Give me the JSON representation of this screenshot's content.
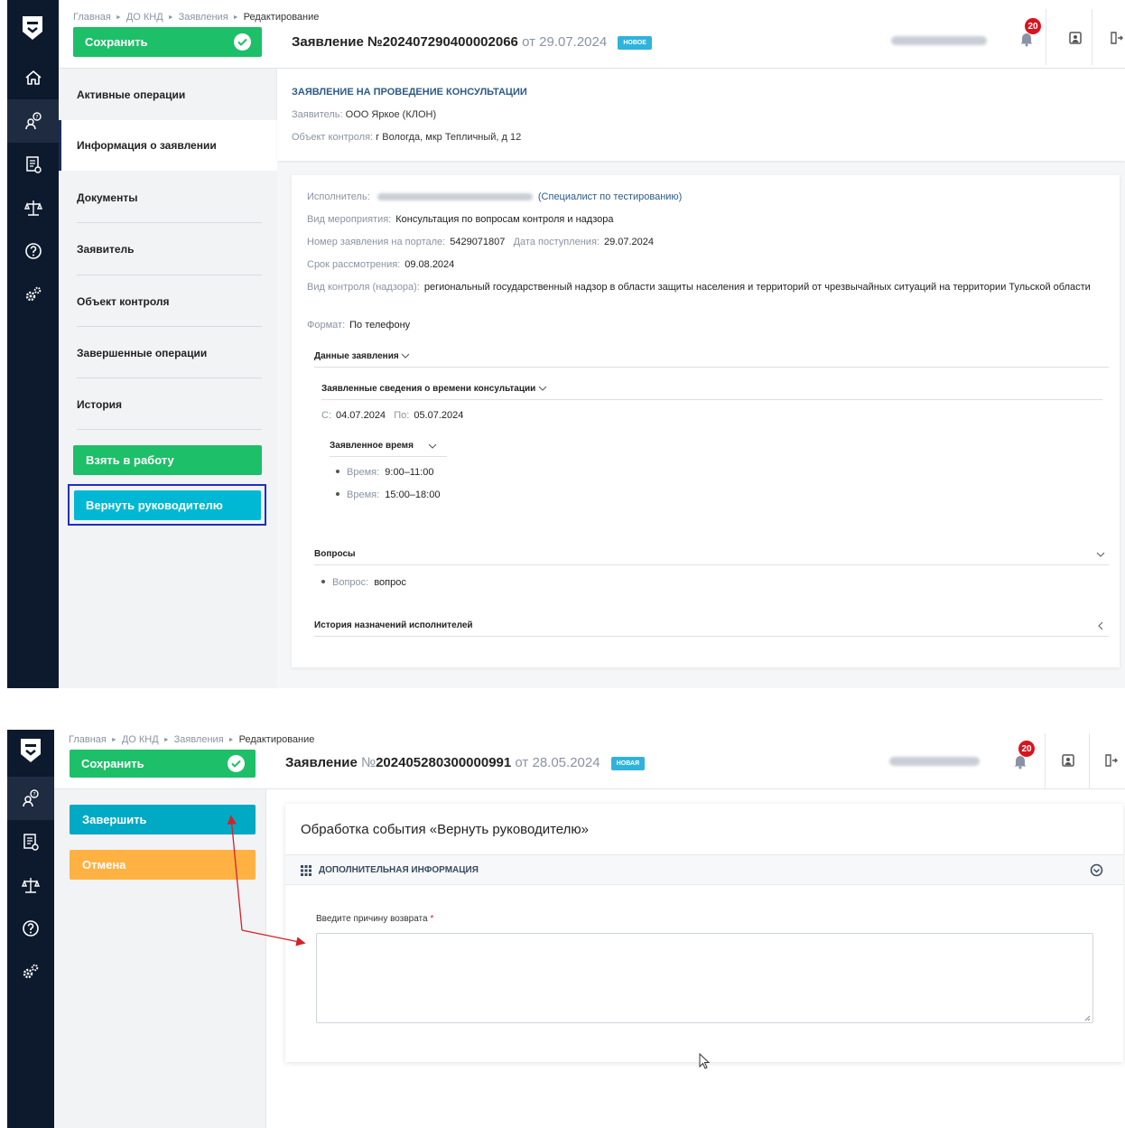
{
  "screen1": {
    "breadcrumbs": [
      "Главная",
      "ДО КНД",
      "Заявления",
      "Редактирование"
    ],
    "save_label": "Сохранить",
    "title": {
      "prefix": "Заявление",
      "number_sign": "№",
      "number": "202407290400002066",
      "date_prefix": "от",
      "date": "29.07.2024",
      "badge": "НОВОЕ"
    },
    "notifications_count": "20",
    "sidebar": {
      "items": [
        {
          "label": "Активные операции"
        },
        {
          "label": "Информация о заявлении"
        },
        {
          "label": "Документы"
        },
        {
          "label": "Заявитель"
        },
        {
          "label": "Объект контроля"
        },
        {
          "label": "Завершенные операции"
        },
        {
          "label": "История"
        }
      ],
      "take_to_work": "Взять в работу",
      "return_to_manager": "Вернуть руководителю"
    },
    "header_card": {
      "title": "ЗАЯВЛЕНИЕ НА ПРОВЕДЕНИЕ КОНСУЛЬТАЦИИ",
      "applicant_label": "Заявитель:",
      "applicant": "ООО Яркое (КЛОН)",
      "object_label": "Объект контроля:",
      "object": "г Вологда, мкр Тепличный, д 12"
    },
    "details": {
      "executor_label": "Исполнитель:",
      "executor_role": "(Специалист по тестированию)",
      "event_type_label": "Вид мероприятия:",
      "event_type": "Консультация по вопросам контроля и надзора",
      "portal_number_label": "Номер заявления на портале:",
      "portal_number": "5429071807",
      "received_label": "Дата поступления:",
      "received": "29.07.2024",
      "deadline_label": "Срок рассмотрения:",
      "deadline": "09.08.2024",
      "control_type_label": "Вид контроля (надзора):",
      "control_type": "региональный государственный надзор в области защиты населения и территорий от чрезвычайных ситуаций на территории Тульской области",
      "format_label": "Формат:",
      "format": "По телефону",
      "app_data_section": "Данные заявления",
      "time_info_section": "Заявленные сведения о времени консультации",
      "from_label": "С:",
      "from": "04.07.2024",
      "to_label": "По:",
      "to": "05.07.2024",
      "declared_time_section": "Заявленное время",
      "times": [
        {
          "label": "Время:",
          "value": "9:00–11:00"
        },
        {
          "label": "Время:",
          "value": "15:00–18:00"
        }
      ],
      "questions_section": "Вопросы",
      "question_label": "Вопрос:",
      "question": "вопрос",
      "history_section": "История назначений исполнителей"
    }
  },
  "screen2": {
    "breadcrumbs": [
      "Главная",
      "ДО КНД",
      "Заявления",
      "Редактирование"
    ],
    "save_label": "Сохранить",
    "title": {
      "prefix": "Заявление",
      "number_sign": "№",
      "number": "202405280300000991",
      "date_prefix": "от",
      "date": "28.05.2024",
      "badge": "НОВАЯ"
    },
    "notifications_count": "20",
    "finish_label": "Завершить",
    "cancel_label": "Отмена",
    "event_title": "Обработка события «Вернуть руководителю»",
    "extra_info": "ДОПОЛНИТЕЛЬНАЯ ИНФОРМАЦИЯ",
    "reason_label": "Введите причину возврата",
    "required_mark": "*",
    "reason_value": ""
  },
  "colors": {
    "rail": "#0d1a2e",
    "save_green": "#1dbf68",
    "return_cyan": "#00b8d4",
    "finish_teal": "#00a9c4",
    "cancel_orange": "#ffb142",
    "badge_blue": "#2fb3dc",
    "notification_red": "#d9141e",
    "annotation_red": "#d2232a",
    "focus_outline": "#1f2ec7"
  }
}
